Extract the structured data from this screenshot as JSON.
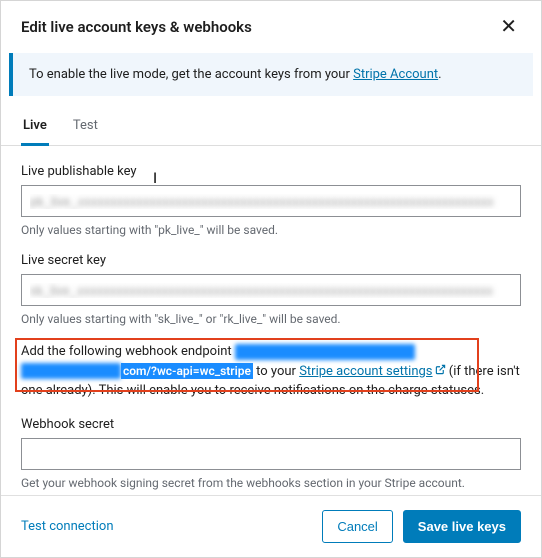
{
  "header": {
    "title": "Edit live account keys & webhooks"
  },
  "banner": {
    "text_before": "To enable the live mode, get the account keys from your ",
    "link_label": "Stripe Account",
    "text_after": "."
  },
  "tabs": {
    "live": "Live",
    "test": "Test"
  },
  "fields": {
    "publishable": {
      "label": "Live publishable key",
      "value": "pk_live_xxxxxxxxxxxxxxxxxxxxxxxxxxxxxxxxxxxxxxxxxxxxxxxxxxxxxxxxxxxxxxxx",
      "hint": "Only values starting with \"pk_live_\" will be saved."
    },
    "secret": {
      "label": "Live secret key",
      "value": "sk_live_xxxxxxxxxxxxxxxxxxxxxxxxxxxxxxxxxxxxxxxxxxxxxxxxxxxxxxxxxxxxxxxx",
      "hint": "Only values starting with \"sk_live_\" or \"rk_live_\" will be saved."
    },
    "webhook_note": {
      "prefix": "Add the following webhook endpoint ",
      "url_fragment": "com/?wc-api=wc_stripe",
      "mid": " to your ",
      "link_label": "Stripe account settings",
      "suffix": " (if there isn't one already). This will enable you to receive notifications on the charge statuses."
    },
    "webhook_secret": {
      "label": "Webhook secret",
      "value": "",
      "hint": "Get your webhook signing secret from the webhooks section in your Stripe account."
    }
  },
  "footer": {
    "test_connection": "Test connection",
    "cancel": "Cancel",
    "save": "Save live keys"
  }
}
